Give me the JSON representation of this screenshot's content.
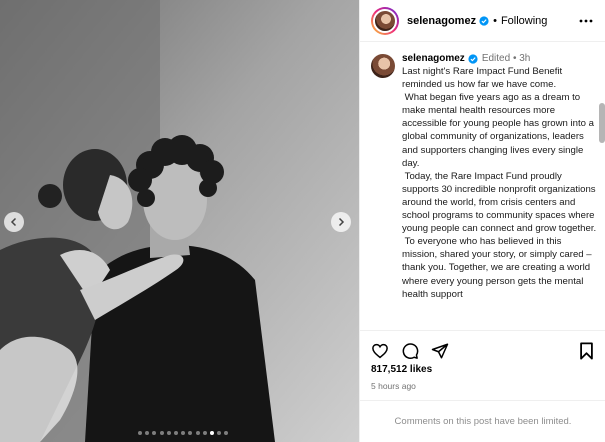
{
  "post": {
    "username": "selenagomez",
    "follow_status": "Following",
    "separator": "•"
  },
  "caption": {
    "username": "selenagomez",
    "meta": "Edited • 3h",
    "text": "Last night's Rare Impact Fund Benefit reminded us how far we have come.\n What began five years ago as a dream to make mental health resources more accessible for young people has grown into a global community of organizations, leaders and supporters changing lives every single day.\n Today, the Rare Impact Fund proudly supports 30 incredible nonprofit organizations around the world, from crisis centers and school programs to community spaces where young people can connect and grow together.\n To everyone who has believed in this mission, shared your story, or simply cared – thank you. Together, we are creating a world where every young person gets the mental health support"
  },
  "stats": {
    "likes": "817,512 likes",
    "time": "5 hours ago"
  },
  "footer": {
    "comments_limited": "Comments on this post have been limited."
  },
  "carousel": {
    "slide_count": 13,
    "active_index": 10
  },
  "icons": {
    "more": "more-options-icon",
    "verified": "verified-badge-icon",
    "like": "heart-icon",
    "comment": "comment-icon",
    "share": "share-icon",
    "save": "bookmark-icon",
    "prev": "chevron-left-icon",
    "next": "chevron-right-icon"
  },
  "colors": {
    "verified": "#0095f6",
    "muted": "#737373"
  }
}
